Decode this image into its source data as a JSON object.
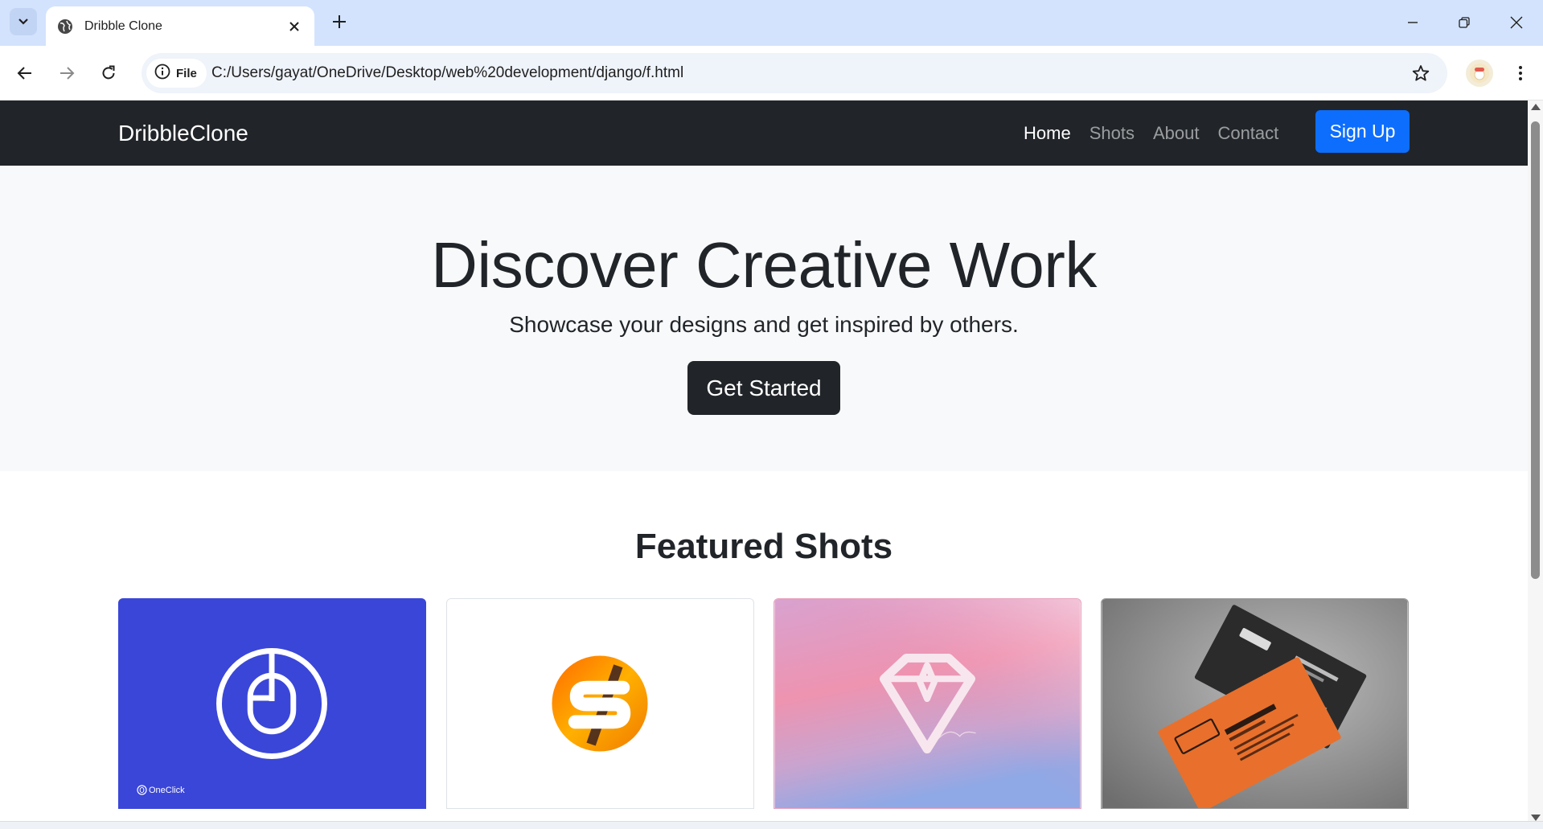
{
  "browser": {
    "tab_title": "Dribble Clone",
    "file_label": "File",
    "url": "C:/Users/gayat/OneDrive/Desktop/web%20development/django/f.html",
    "icons": [
      "tab-search-icon",
      "globe-icon",
      "close-icon",
      "plus-icon",
      "minimize-icon",
      "restore-icon",
      "window-close-icon",
      "back-icon",
      "forward-icon",
      "reload-icon",
      "info-icon",
      "star-icon",
      "profile-icon",
      "kebab-icon"
    ]
  },
  "navbar": {
    "brand": "DribbleClone",
    "links": [
      {
        "label": "Home",
        "active": true
      },
      {
        "label": "Shots",
        "active": false
      },
      {
        "label": "About",
        "active": false
      },
      {
        "label": "Contact",
        "active": false
      }
    ],
    "signup_label": "Sign Up",
    "signup_color": "#0d6efd"
  },
  "hero": {
    "title": "Discover Creative Work",
    "subtitle": "Showcase your designs and get inspired by others.",
    "cta_label": "Get Started"
  },
  "featured": {
    "title": "Featured Shots",
    "cards": [
      {
        "name": "mouse-logo-shot",
        "bg": "#3a46d8",
        "watermark": "OneClick"
      },
      {
        "name": "s-logo-shot",
        "bg": "#ffffff"
      },
      {
        "name": "diamond-logo-shot",
        "bg": "#e89ab8"
      },
      {
        "name": "business-card-shot",
        "bg": "#8d8d8d"
      }
    ]
  }
}
